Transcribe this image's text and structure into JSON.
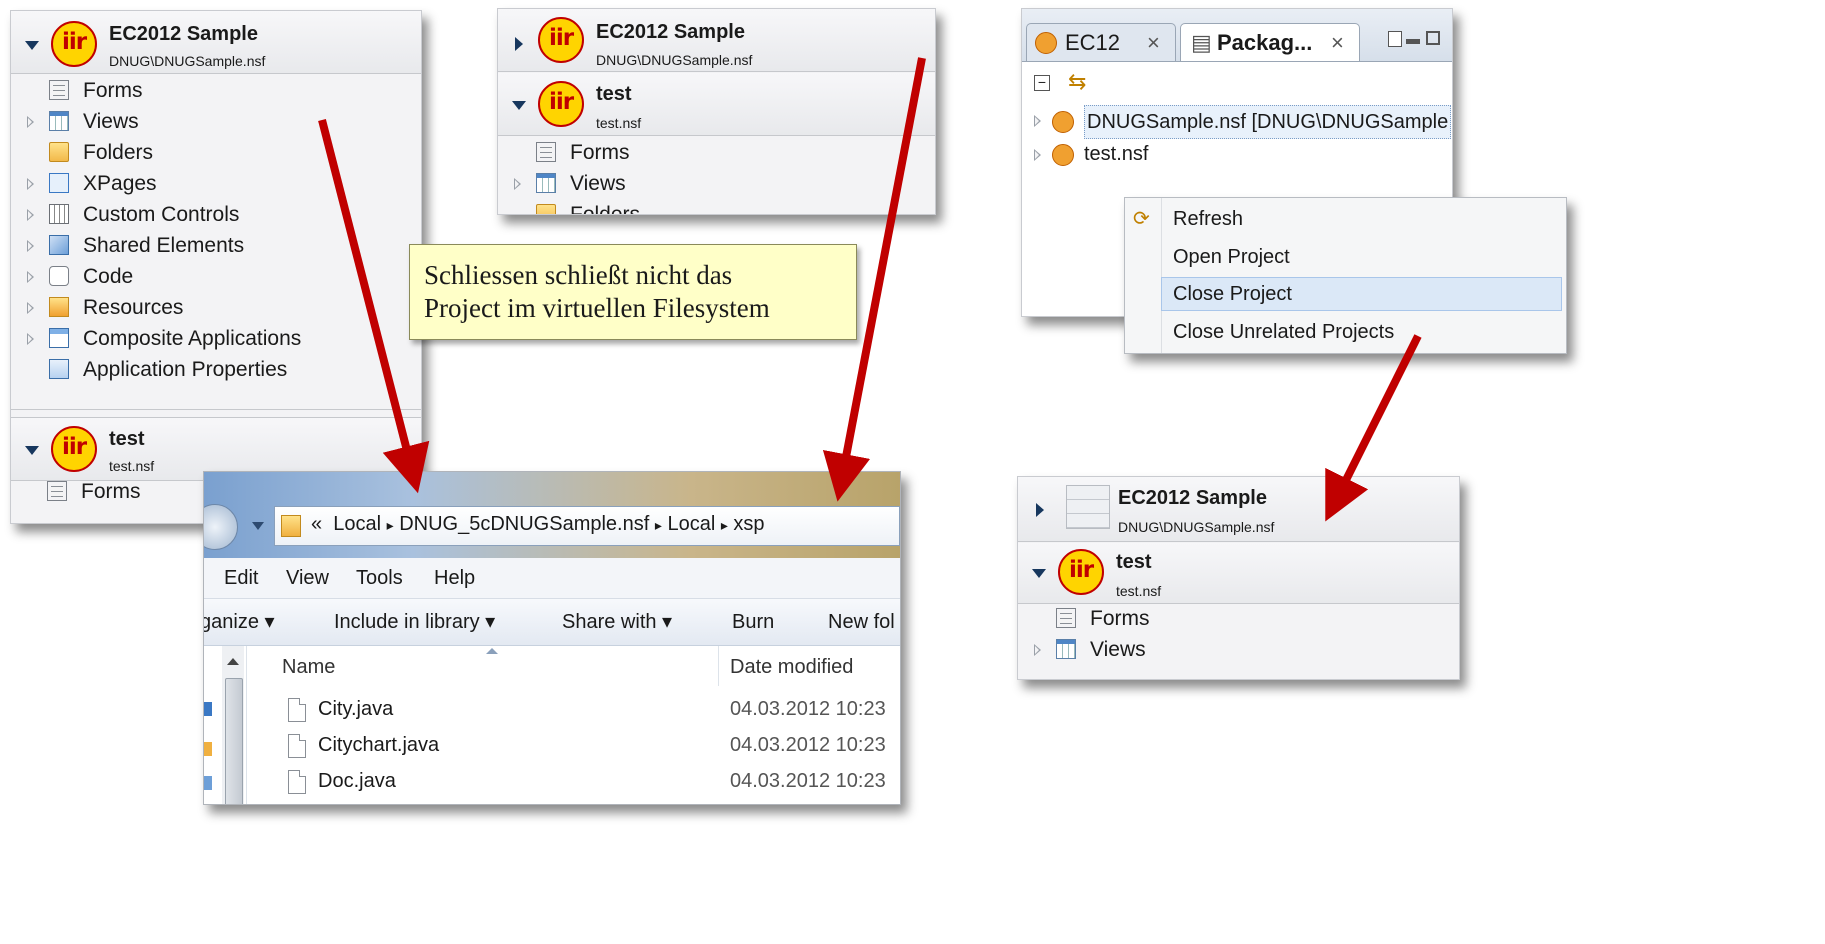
{
  "colors": {
    "arrow": "#c00000",
    "callout_bg": "#ffffc8",
    "logo_yellow": "#ffd400",
    "logo_red": "#c00000"
  },
  "logo_text": "iir",
  "panel1": {
    "db1": {
      "title": "EC2012 Sample",
      "subtitle": "DNUG\\DNUGSample.nsf"
    },
    "items": [
      {
        "label": "Forms",
        "icon": "form-icon"
      },
      {
        "label": "Views",
        "icon": "view-icon"
      },
      {
        "label": "Folders",
        "icon": "folder-icon"
      },
      {
        "label": "XPages",
        "icon": "xpage-icon"
      },
      {
        "label": "Custom Controls",
        "icon": "custom-control-icon"
      },
      {
        "label": "Shared Elements",
        "icon": "shared-elements-icon"
      },
      {
        "label": "Code",
        "icon": "code-icon"
      },
      {
        "label": "Resources",
        "icon": "resources-icon"
      },
      {
        "label": "Composite Applications",
        "icon": "composite-app-icon"
      },
      {
        "label": "Application Properties",
        "icon": "app-properties-icon"
      }
    ],
    "db2": {
      "title": "test",
      "subtitle": "test.nsf"
    },
    "db2_items": [
      {
        "label": "Forms"
      }
    ]
  },
  "panel2": {
    "db1": {
      "title": "EC2012 Sample",
      "subtitle": "DNUG\\DNUGSample.nsf"
    },
    "db2": {
      "title": "test",
      "subtitle": "test.nsf"
    },
    "items": [
      {
        "label": "Forms"
      },
      {
        "label": "Views"
      },
      {
        "label": "Folders"
      }
    ]
  },
  "callout": {
    "line1": "Schliessen schließt nicht das",
    "line2": "Project im virtuellen Filesystem"
  },
  "package_explorer": {
    "tabs": [
      {
        "label": "EC12",
        "close": "×"
      },
      {
        "label": "Packag...",
        "close": "×"
      }
    ],
    "rows": [
      {
        "label": "DNUGSample.nsf [DNUG\\DNUGSample"
      },
      {
        "label": "test.nsf"
      }
    ]
  },
  "context_menu": {
    "items": [
      "Refresh",
      "Open Project",
      "Close Project",
      "Close Unrelated Projects"
    ],
    "highlighted": "Close Project"
  },
  "panel3": {
    "db1": {
      "title": "EC2012 Sample",
      "subtitle": "DNUG\\DNUGSample.nsf"
    },
    "db2": {
      "title": "test",
      "subtitle": "test.nsf"
    },
    "items": [
      {
        "label": "Forms"
      },
      {
        "label": "Views"
      }
    ]
  },
  "explorer": {
    "breadcrumb": {
      "prefix": "«",
      "parts": [
        "Local",
        "DNUG_5cDNUGSample.nsf",
        "Local",
        "xsp"
      ],
      "sep": "▸"
    },
    "menu": [
      "Edit",
      "View",
      "Tools",
      "Help"
    ],
    "toolbar": [
      "ganize ▾",
      "Include in library ▾",
      "Share with ▾",
      "Burn",
      "New fol"
    ],
    "columns": {
      "name": "Name",
      "date": "Date modified"
    },
    "files": [
      {
        "name": "City.java",
        "date": "04.03.2012 10:23"
      },
      {
        "name": "Citychart.java",
        "date": "04.03.2012 10:23"
      },
      {
        "name": "Doc.java",
        "date": "04.03.2012 10:23"
      }
    ]
  }
}
